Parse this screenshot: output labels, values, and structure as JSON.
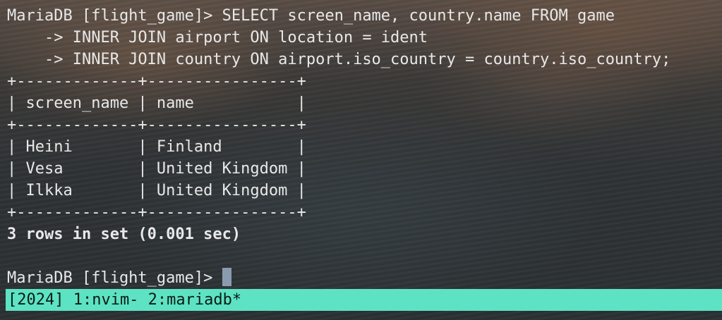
{
  "query": {
    "line1": "MariaDB [flight_game]> SELECT screen_name, country.name FROM game",
    "line2": "    -> INNER JOIN airport ON location = ident",
    "line3": "    -> INNER JOIN country ON airport.iso_country = country.iso_country;"
  },
  "result_table": {
    "border": "+-------------+----------------+",
    "header_row": "| screen_name | name           |",
    "columns": [
      "screen_name",
      "name"
    ],
    "rows": [
      {
        "screen_name": "Heini",
        "name": "Finland",
        "text": "| Heini       | Finland        |"
      },
      {
        "screen_name": "Vesa",
        "name": "United Kingdom",
        "text": "| Vesa        | United Kingdom |"
      },
      {
        "screen_name": "Ilkka",
        "name": "United Kingdom",
        "text": "| Ilkka       | United Kingdom |"
      }
    ]
  },
  "summary": "3 rows in set (0.001 sec)",
  "prompt": "MariaDB [flight_game]> ",
  "tmux_status": {
    "text": "[2024] 1:nvim- 2:mariadb*",
    "session": "[2024]",
    "windows": [
      "1:nvim-",
      "2:mariadb*"
    ],
    "bg_color": "#5de3c3"
  },
  "colors": {
    "text": "#e8e8e8",
    "cursor": "#8a9bb0"
  }
}
